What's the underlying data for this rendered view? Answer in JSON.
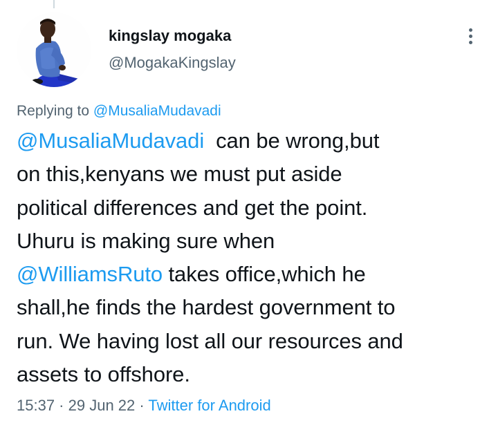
{
  "author": {
    "display_name": "kingslay mogaka",
    "handle": "@MogakaKingslay"
  },
  "reply_context": {
    "prefix": "Replying to ",
    "mention": "@MusaliaMudavadi"
  },
  "tweet": {
    "lines": [
      [
        {
          "text": "@MusaliaMudavadi",
          "link": true
        },
        {
          "text": "  can be wrong,but",
          "link": false
        }
      ],
      [
        {
          "text": "on this,kenyans we must put aside",
          "link": false
        }
      ],
      [
        {
          "text": "political differences and get the point.",
          "link": false
        }
      ],
      [
        {
          "text": "Uhuru is making sure when",
          "link": false
        }
      ],
      [
        {
          "text": "@WilliamsRuto",
          "link": true
        },
        {
          "text": " takes office,which he",
          "link": false
        }
      ],
      [
        {
          "text": "shall,he finds the hardest government to",
          "link": false
        }
      ],
      [
        {
          "text": "run. We having lost all our resources and",
          "link": false
        }
      ],
      [
        {
          "text": "assets to offshore.",
          "link": false
        }
      ]
    ]
  },
  "meta": {
    "time": "15:37",
    "separator": " · ",
    "date": "29 Jun 22",
    "source": "Twitter for Android"
  },
  "colors": {
    "link": "#1d9bf0",
    "secondary_text": "#536471",
    "primary_text": "#0f1419"
  },
  "icons": {
    "more": "more-vertical-icon",
    "avatar": "profile-photo"
  }
}
